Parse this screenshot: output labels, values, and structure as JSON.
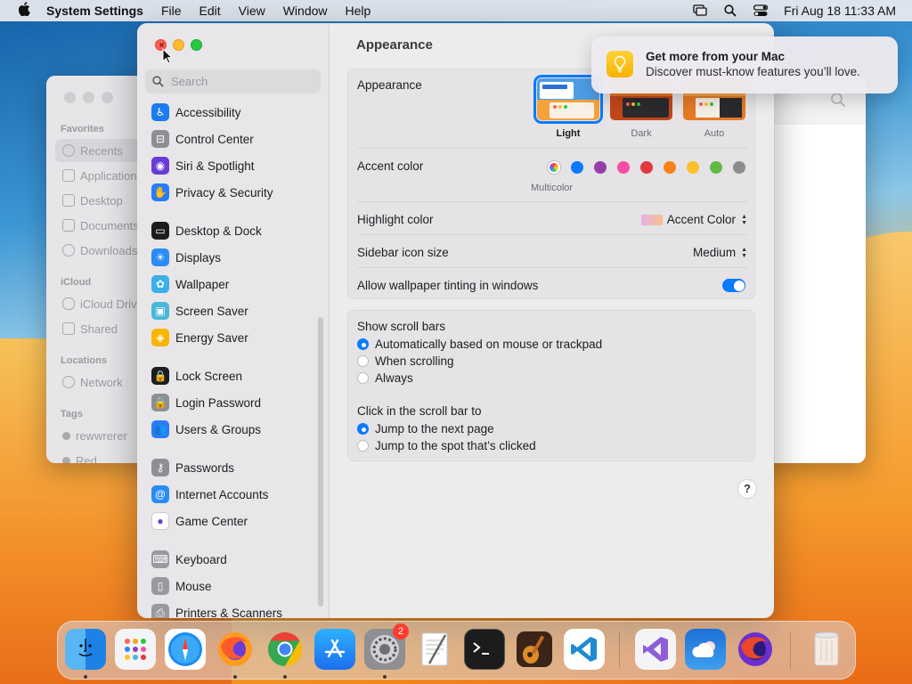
{
  "menubar": {
    "app_name": "System Settings",
    "menus": [
      "File",
      "Edit",
      "View",
      "Window",
      "Help"
    ],
    "datetime": "Fri Aug 18  11:33 AM"
  },
  "finder": {
    "sections": {
      "favorites": "Favorites",
      "icloud": "iCloud",
      "locations": "Locations",
      "tags": "Tags"
    },
    "items": [
      "Recents",
      "Applications",
      "Desktop",
      "Documents",
      "Downloads",
      "iCloud Drive",
      "Shared",
      "Network",
      "rewwrerer",
      "Red"
    ]
  },
  "sidebar": {
    "search_placeholder": "Search",
    "items": [
      {
        "label": "Accessibility",
        "color": "#1a7cf0",
        "glyph": "♿"
      },
      {
        "label": "Control Center",
        "color": "#8e8e93",
        "glyph": "⊟"
      },
      {
        "label": "Siri & Spotlight",
        "color": "#6a3bd6",
        "glyph": "◉"
      },
      {
        "label": "Privacy & Security",
        "color": "#2a7cf6",
        "glyph": "✋"
      },
      {
        "label": "Desktop & Dock",
        "color": "#1c1c1e",
        "glyph": "▭"
      },
      {
        "label": "Displays",
        "color": "#2a8cf5",
        "glyph": "☀"
      },
      {
        "label": "Wallpaper",
        "color": "#3cb0e8",
        "glyph": "✿"
      },
      {
        "label": "Screen Saver",
        "color": "#4ab8d8",
        "glyph": "▣"
      },
      {
        "label": "Energy Saver",
        "color": "#f7b500",
        "glyph": "◈"
      },
      {
        "label": "Lock Screen",
        "color": "#1c1c1e",
        "glyph": "🔒"
      },
      {
        "label": "Login Password",
        "color": "#8e8e93",
        "glyph": "🔒"
      },
      {
        "label": "Users & Groups",
        "color": "#2a7cf6",
        "glyph": "👥"
      },
      {
        "label": "Passwords",
        "color": "#8e8e93",
        "glyph": "⚷"
      },
      {
        "label": "Internet Accounts",
        "color": "#2a8cf5",
        "glyph": "@"
      },
      {
        "label": "Game Center",
        "color": "#ffffff",
        "glyph": "●"
      },
      {
        "label": "Keyboard",
        "color": "#9a9a9e",
        "glyph": "⌨"
      },
      {
        "label": "Mouse",
        "color": "#9a9a9e",
        "glyph": "▯"
      },
      {
        "label": "Printers & Scanners",
        "color": "#9a9a9e",
        "glyph": "⎙"
      }
    ]
  },
  "content": {
    "title": "Appearance",
    "appearance": {
      "label": "Appearance",
      "options": [
        "Light",
        "Dark",
        "Auto"
      ],
      "selected": "Light"
    },
    "accent": {
      "label": "Accent color",
      "selected_name": "Multicolor",
      "colors": [
        "#6a6a6a",
        "#0a7aff",
        "#953ea8",
        "#f44fa0",
        "#e0383e",
        "#f7821b",
        "#fdc02c",
        "#62ba46",
        "#8c8c8c"
      ]
    },
    "highlight": {
      "label": "Highlight color",
      "value": "Accent Color"
    },
    "sidebar_icon_size": {
      "label": "Sidebar icon size",
      "value": "Medium"
    },
    "wallpaper_tinting": {
      "label": "Allow wallpaper tinting in windows",
      "on": true
    },
    "scroll_bars": {
      "label": "Show scroll bars",
      "options": [
        "Automatically based on mouse or trackpad",
        "When scrolling",
        "Always"
      ],
      "selected_index": 0
    },
    "click_scroll": {
      "label": "Click in the scroll bar to",
      "options": [
        "Jump to the next page",
        "Jump to the spot that’s clicked"
      ],
      "selected_index": 0
    },
    "help": "?"
  },
  "notification": {
    "title": "Get more from your Mac",
    "body": "Discover must-know features you’ll love."
  },
  "dock": {
    "settings_badge": "2",
    "apps": [
      "Finder",
      "Launchpad",
      "Safari",
      "Firefox",
      "Chrome",
      "App Store",
      "System Settings",
      "TextEdit",
      "Terminal",
      "GarageBand",
      "VS Code",
      "Visual Studio",
      "Weather",
      "Firefox Nightly",
      "Trash"
    ]
  }
}
